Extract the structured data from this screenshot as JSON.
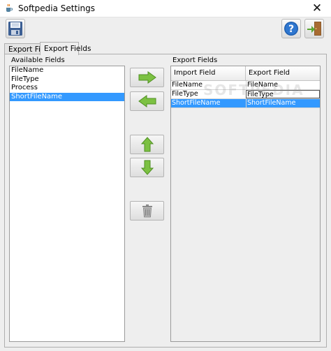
{
  "window": {
    "title": "Softpedia Settings",
    "close_glyph": "✕",
    "app_icon": "java-cup-icon"
  },
  "toolbar": {
    "save_icon": "floppy-disk-icon",
    "help_icon": "help-icon",
    "exit_icon": "exit-door-icon"
  },
  "tabs": [
    {
      "label": "Export Files",
      "active": false
    },
    {
      "label": "Export Fields",
      "active": true
    }
  ],
  "available_fields": {
    "label": "Available Fields",
    "items": [
      "FileName",
      "FileType",
      "Process",
      "ShortFileName"
    ],
    "selected_index": 3
  },
  "middle_buttons": {
    "add_icon": "arrow-right-icon",
    "remove_icon": "arrow-left-icon",
    "up_icon": "arrow-up-icon",
    "down_icon": "arrow-down-icon",
    "delete_icon": "trash-icon"
  },
  "export_fields": {
    "label": "Export Fields",
    "columns": [
      "Import Field",
      "Export Field"
    ],
    "rows": [
      {
        "import": "FileName",
        "export": "FileName"
      },
      {
        "import": "FileType",
        "export": "FileType"
      },
      {
        "import": "ShortFileName",
        "export": "ShortFileName"
      }
    ],
    "selected_index": 2,
    "watermark": "SOFTPEDIA"
  },
  "colors": {
    "selection": "#3399ff",
    "arrow_green": "#7cc142"
  }
}
